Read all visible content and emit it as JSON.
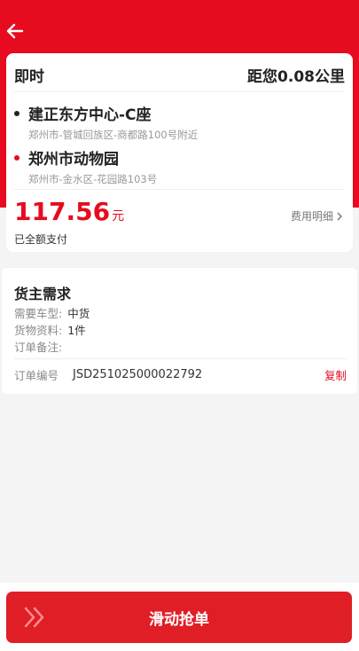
{
  "header": {
    "back_icon": "arrow-left-icon"
  },
  "order_card": {
    "type": "即时",
    "distance": "距您0.08公里",
    "pickup": {
      "name": "建正东方中心-C座",
      "address": "郑州市-管城回族区-商都路100号附近"
    },
    "dropoff": {
      "name": "郑州市动物园",
      "address": "郑州市-金水区-花园路103号"
    },
    "price": "117.56",
    "price_unit": "元",
    "payment_status": "已全额支付",
    "fee_detail": "费用明细"
  },
  "requirements": {
    "title": "货主需求",
    "vehicle_label": "需要车型:",
    "vehicle_value": "中货",
    "goods_label": "货物资料:",
    "goods_value": "1件",
    "remark_label": "订单备注:",
    "order_no_label": "订单编号",
    "order_no": "JSD251025000022792",
    "copy_label": "复制"
  },
  "action": {
    "grab_label": "滑动抢单"
  },
  "colors": {
    "brand_red": "#e60b1e",
    "pickup_dot": "#222222",
    "dropoff_dot": "#e60b1e"
  }
}
